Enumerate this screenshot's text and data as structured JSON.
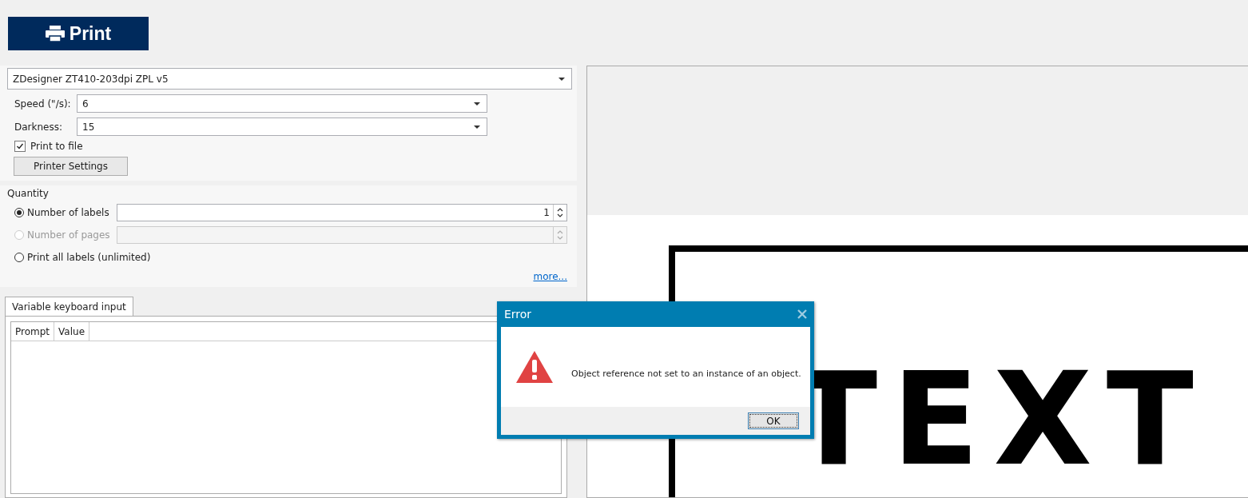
{
  "print_button": {
    "label": "Print"
  },
  "printer": {
    "value": "ZDesigner ZT410-203dpi ZPL v5"
  },
  "settings": [
    {
      "label": "Speed (\"/s):",
      "value": "6"
    },
    {
      "label": "Darkness:",
      "value": "15"
    }
  ],
  "print_to_file": {
    "label": "Print to file",
    "checked": true
  },
  "printer_settings_button": {
    "label": "Printer Settings"
  },
  "quantity": {
    "title": "Quantity",
    "options": [
      {
        "label": "Number of labels",
        "selected": true,
        "disabled": false,
        "kind": "field",
        "value": "1"
      },
      {
        "label": "Number of pages",
        "selected": false,
        "disabled": true,
        "kind": "field"
      },
      {
        "label": "Print all labels (unlimited)",
        "selected": false,
        "disabled": false,
        "kind": "plain"
      }
    ],
    "more_link": "more..."
  },
  "tabs": [
    {
      "label": "Variable keyboard input",
      "selected": true
    }
  ],
  "table": {
    "columns": [
      "Prompt",
      "Value"
    ]
  },
  "preview": {
    "label_text": "TEXT"
  },
  "dialog": {
    "title": "Error",
    "message": "Object reference not set to an instance of an object.",
    "buttons": [
      "OK"
    ]
  }
}
